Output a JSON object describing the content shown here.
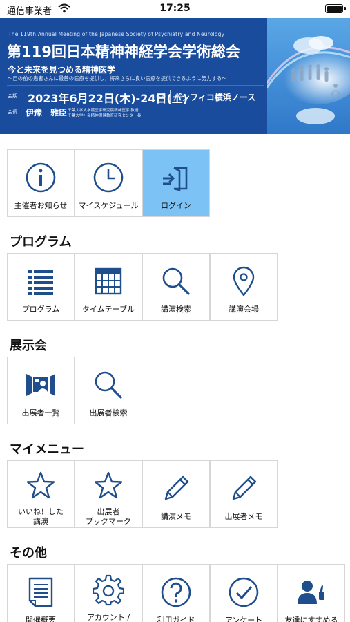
{
  "status_bar": {
    "carrier": "通信事業者",
    "time": "17:25"
  },
  "banner": {
    "english_title": "The 119th Annual Meeting of the Japanese Society of Psychiatry and Neurology",
    "title": "第119回日本精神神経学会学術総会",
    "subtitle": "今と未来を見つめる精神医学",
    "tagline": "～目の前の患者さんに最善の医療を提供し，将来さらに良い医療を提供できるように努力する～",
    "period_label": "会期",
    "date": "2023年6月22日(木)-24日(土)",
    "venue_label": "会場",
    "venue": "パシフィコ横浜ノース",
    "chair_label": "会長",
    "chair": "伊豫　雅臣",
    "chair_affiliation_1": "千葉大学大学院医学研究院精神医学 教授",
    "chair_affiliation_2": "千葉大学社会精神保健教育研究センター長"
  },
  "top_tiles": [
    {
      "label": "主催者お知らせ",
      "icon": "info-icon"
    },
    {
      "label": "マイスケジュール",
      "icon": "clock-icon"
    },
    {
      "label": "ログイン",
      "icon": "login-icon"
    }
  ],
  "sections": {
    "program": {
      "title": "プログラム",
      "tiles": [
        {
          "label": "プログラム",
          "icon": "list-icon"
        },
        {
          "label": "タイムテーブル",
          "icon": "calendar-icon"
        },
        {
          "label": "講演検索",
          "icon": "search-icon"
        },
        {
          "label": "講演会場",
          "icon": "location-pin-icon"
        }
      ]
    },
    "exhibition": {
      "title": "展示会",
      "tiles": [
        {
          "label": "出展者一覧",
          "icon": "exhibitor-booth-icon"
        },
        {
          "label": "出展者検索",
          "icon": "search-icon"
        }
      ]
    },
    "mymenu": {
      "title": "マイメニュー",
      "tiles": [
        {
          "label_line1": "いいね！した",
          "label_line2": "講演",
          "icon": "star-icon"
        },
        {
          "label_line1": "出展者",
          "label_line2": "ブックマーク",
          "icon": "star-icon"
        },
        {
          "label": "講演メモ",
          "icon": "pencil-icon"
        },
        {
          "label": "出展者メモ",
          "icon": "pencil-icon"
        }
      ]
    },
    "other": {
      "title": "その他",
      "tiles": [
        {
          "label": "開催概要",
          "icon": "document-icon"
        },
        {
          "label_line1": "アカウント /",
          "icon": "gear-icon"
        },
        {
          "label": "利用ガイド",
          "icon": "help-icon"
        },
        {
          "label": "アンケート",
          "icon": "checkmark-icon"
        },
        {
          "label": "友達にすすめる",
          "icon": "recommend-icon"
        }
      ]
    }
  },
  "colors": {
    "banner_blue": "#1a4c9d",
    "icon_blue": "#1f4e8c",
    "active_tile": "#7cc2f5"
  }
}
